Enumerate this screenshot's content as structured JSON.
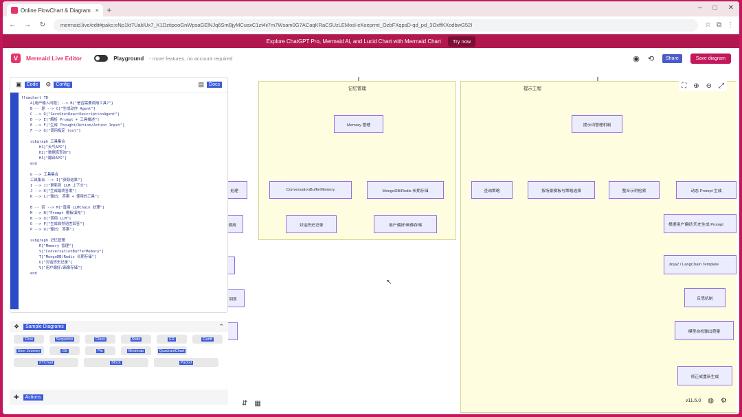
{
  "browser": {
    "tab_title": "Online FlowChart & Diagram",
    "url": "mermaid.live/edit#pako:eNp1kt7UaklUx7_K1DztipooGnWpsaGElNJq6SmBjyMCuaxC1zt4ii7m7Wsam0G7ACaqKRaCSUzLEMosl-eKoeprmt_OzbFXqpsD-qd_pd_3OxffKXodbwG52I",
    "tab_close": "×",
    "new_tab": "+"
  },
  "banner": {
    "text": "Explore ChatGPT Pro, Mermaid Ai, and Lucid Chart with Mermaid Chart",
    "cta": "Try now"
  },
  "header": {
    "app_name": "Mermaid Live Editor",
    "playground": "Playground",
    "playground_sub": "- more features, no account required",
    "share": "Share",
    "save": "Save diagram"
  },
  "left": {
    "tab_code": "Code",
    "tab_config": "Config",
    "docs": "Docs",
    "code_lines": [
      "flowchart TD",
      "    A[用户输入问题] --> B{\"是否需要调用工具?\"}",
      "    B -- 是 --> C[\"生成动作 Agent\"]",
      "    C --> D[\"ZeroShotReactDescriptionAgent\"]",
      "    D --> E[\"解析 Prompt + 工具描述\"]",
      "    E --> F[\"生成 Thought/Action/Action Input\"]",
      "    F --> G[\"调用指定 tool\"]",
      "",
      "    subgraph 工具集合",
      "        H1[\"天气API\"]",
      "        H2[\"数据库查询\"]",
      "        H3[\"翻译API\"]",
      "    end",
      "",
      "    G --> 工具集合",
      "    工具集合 --> I[\"获取结果\"]",
      "    I --> J[\"更新到 LLM 上下文\"]",
      "    J --> K[\"生成最终答案\"]",
      "    K --> L[\"输出: 答案 + 使用的工具\"]",
      "",
      "    B -- 否 --> M[\"直接 LLMChain 处理\"]",
      "    M --> N[\"Prompt 模板填充\"]",
      "    N --> O[\"调用 LLM\"]",
      "    O --> P[\"生成自然语言回答\"]",
      "    P --> Q[\"输出: 答案\"]",
      "",
      "    subgraph 记忆管理",
      "        R[\"Memory 管理\"]",
      "        S[\"ConversationBufferMemory\"]",
      "        T[\"MongoDB/Redis 长期存储\"]",
      "        U[\"对话历史记录\"]",
      "        V[\"用户偏好/画像存储\"]",
      "    end",
      ""
    ],
    "line_numbers": [
      "1",
      "2",
      "3",
      "4",
      "5",
      "6",
      "7",
      "8",
      "9",
      "10",
      "11",
      "12",
      "13",
      "14",
      "15",
      "16",
      "17",
      "18",
      "19",
      "20",
      "21",
      "22",
      "23",
      "24",
      "25",
      "26",
      "27",
      "28",
      "29",
      "30",
      "31",
      "32",
      "33",
      "34",
      "35",
      "36",
      "37",
      "38"
    ]
  },
  "samples": {
    "title": "Sample Diagrams",
    "items": [
      "Flow",
      "Sequence",
      "Class",
      "State",
      "ER",
      "Gantt",
      "User Journey",
      "Git",
      "Pie",
      "Mindmap",
      "QuadrantChart",
      "XYChart",
      "Block",
      "Packet"
    ]
  },
  "actions": {
    "title": "Actions"
  },
  "diagram": {
    "sg1_label": "记忆管理",
    "sg2_label": "提示工程",
    "memory": "Memory 管理",
    "conv": "ConversationBufferMemory",
    "mongo": "MongoDB/Redis 长期存储",
    "hist": "对话历史记录",
    "pref": "用户偏好/画像存储",
    "prompt_mgr": "提示词管理机制",
    "p1": "查询策略",
    "p2": "按场景模板与策略选择",
    "p3": "整合示例检索",
    "p4": "动态 Prompt 生成",
    "p5": "根据用户偏好/历史生成 Prompt",
    "p6": "Jinja2 / LangChain Template",
    "p7": "反思机制",
    "p8": "模型自检输出质量",
    "p9": "修正或重新生成",
    "left_partials": [
      "处理",
      "调用",
      "",
      "回答",
      ""
    ],
    "version": "v11.6.0"
  },
  "icons": {
    "github": "github-icon",
    "history": "history-icon",
    "fit": "fit-icon",
    "zoom_in": "zoom-in-icon",
    "zoom_out": "zoom-out-icon",
    "expand": "expand-icon"
  }
}
